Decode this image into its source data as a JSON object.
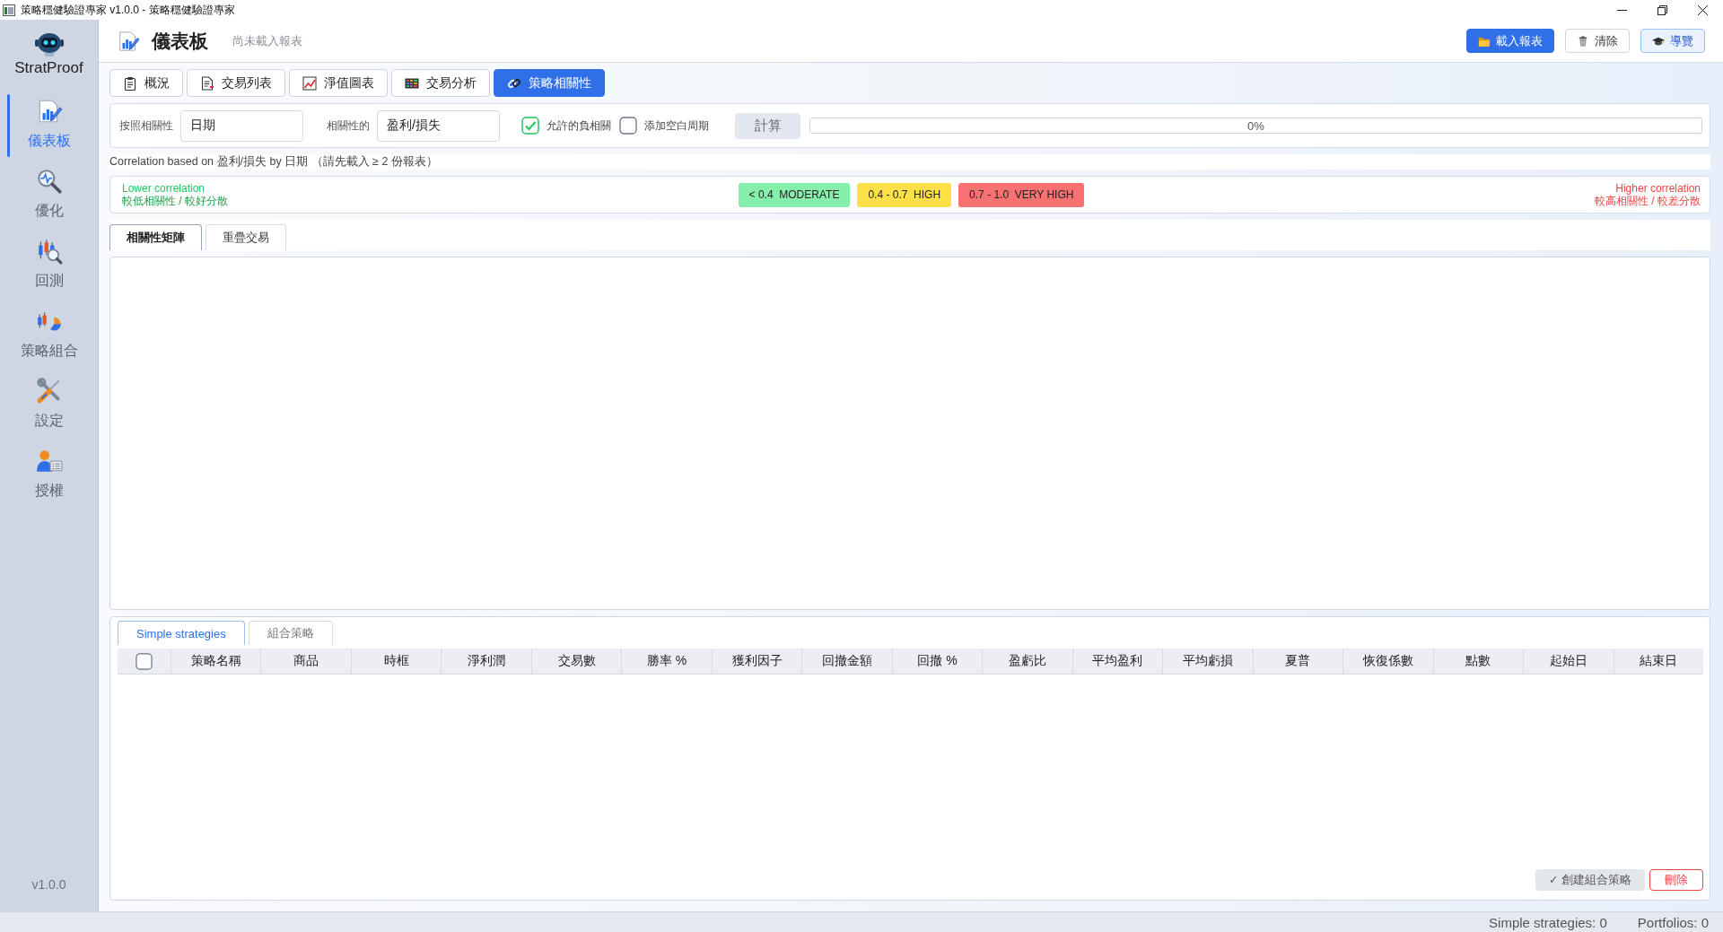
{
  "window": {
    "title": "策略穩健驗證專家 v1.0.0 - 策略穩健驗證專家"
  },
  "sidebar": {
    "brand": "StratProof",
    "items": [
      {
        "label": "儀表板",
        "selected": true
      },
      {
        "label": "優化",
        "selected": false
      },
      {
        "label": "回測",
        "selected": false
      },
      {
        "label": "策略組合",
        "selected": false
      },
      {
        "label": "設定",
        "selected": false
      },
      {
        "label": "授權",
        "selected": false
      }
    ],
    "version": "v1.0.0"
  },
  "header": {
    "title": "儀表板",
    "subtitle": "尚未載入報表",
    "buttons": [
      {
        "label": "載入報表",
        "kind": "primary"
      },
      {
        "label": "清除",
        "kind": "default"
      },
      {
        "label": "導覽",
        "kind": "accent"
      }
    ]
  },
  "tabs": [
    {
      "label": "概況",
      "selected": false
    },
    {
      "label": "交易列表",
      "selected": false
    },
    {
      "label": "淨值圖表",
      "selected": false
    },
    {
      "label": "交易分析",
      "selected": false
    },
    {
      "label": "策略相關性",
      "selected": true
    }
  ],
  "controls": {
    "group_by": {
      "label": "按照相關性",
      "value": "日期"
    },
    "metric": {
      "label": "相關性的",
      "value": "盈利/損失"
    },
    "options": [
      {
        "label": "允許的負相關",
        "checked": true
      },
      {
        "label": "添加空白周期",
        "checked": false
      }
    ],
    "compute_button": "計算",
    "progress": {
      "reading": "0%"
    }
  },
  "summary": "Correlation based on 盈利/損失 by 日期 （請先載入 ≥ 2 份報表）",
  "legend": {
    "low": {
      "title": "Lower correlation",
      "note": "較低相關性 / 較好分散"
    },
    "badges": [
      {
        "label": "< 0.4  MODERATE",
        "color": "#86efac"
      },
      {
        "label": "0.4 - 0.7  HIGH",
        "color": "#fde047"
      },
      {
        "label": "0.7 - 1.0  VERY HIGH",
        "color": "#f87171"
      }
    ],
    "high": {
      "title": "Higher correlation",
      "note": "較高相關性 / 較差分散"
    }
  },
  "view_tabs": [
    {
      "label": "相關性矩陣",
      "selected": true
    },
    {
      "label": "重疊交易",
      "selected": false
    }
  ],
  "strategy_table": {
    "tabs": [
      {
        "label": "Simple strategies",
        "selected": true
      },
      {
        "label": "組合策略",
        "selected": false
      }
    ],
    "select_all": {
      "checked": false
    },
    "columns": [
      "策略名稱",
      "商品",
      "時框",
      "淨利潤",
      "交易數",
      "勝率 %",
      "獲利因子",
      "回撤金額",
      "回撤 %",
      "盈虧比",
      "平均盈利",
      "平均虧損",
      "夏普",
      "恢復係數",
      "點數",
      "起始日",
      "結束日"
    ],
    "buttons": [
      {
        "label": "✓ 創建組合策略",
        "kind": "secondary"
      },
      {
        "label": "刪除",
        "kind": "danger"
      }
    ]
  },
  "status_bar": {
    "items": [
      "Simple strategies: 0",
      "Portfolios: 0"
    ]
  }
}
